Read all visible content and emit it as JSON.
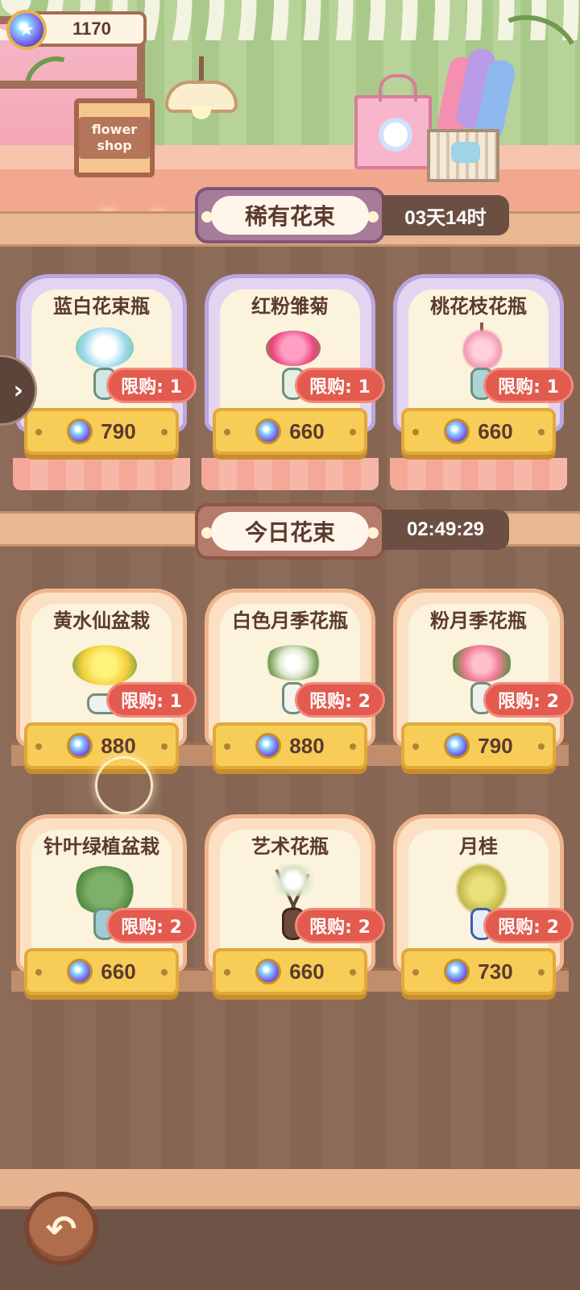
{
  "currency": {
    "amount": "1170",
    "icon": "star-gem-icon"
  },
  "rare_section": {
    "title": "稀有花束",
    "timer": "03天14时"
  },
  "daily_section": {
    "title": "今日花束",
    "timer": "02:49:29"
  },
  "sign": {
    "text": "flower shop"
  },
  "rare_items": [
    {
      "name": "蓝白花束瓶",
      "limit": "限购: 1",
      "price": "790"
    },
    {
      "name": "红粉雏菊",
      "limit": "限购: 1",
      "price": "660"
    },
    {
      "name": "桃花枝花瓶",
      "limit": "限购: 1",
      "price": "660"
    }
  ],
  "daily_items": [
    {
      "name": "黄水仙盆栽",
      "limit": "限购: 1",
      "price": "880"
    },
    {
      "name": "白色月季花瓶",
      "limit": "限购: 2",
      "price": "880"
    },
    {
      "name": "粉月季花瓶",
      "limit": "限购: 2",
      "price": "790"
    },
    {
      "name": "针叶绿植盆栽",
      "limit": "限购: 2",
      "price": "660"
    },
    {
      "name": "艺术花瓶",
      "limit": "限购: 2",
      "price": "660"
    },
    {
      "name": "月桂",
      "limit": "限购: 2",
      "price": "730"
    }
  ],
  "controls": {
    "side_tab_icon": "chevron-right-icon",
    "back_icon": "return-arrow-icon"
  },
  "colors": {
    "rare_frame": "#bba6df",
    "daily_frame": "#f0b58d",
    "limit_badge": "#e35a4e",
    "price_button": "#f7cd57"
  }
}
